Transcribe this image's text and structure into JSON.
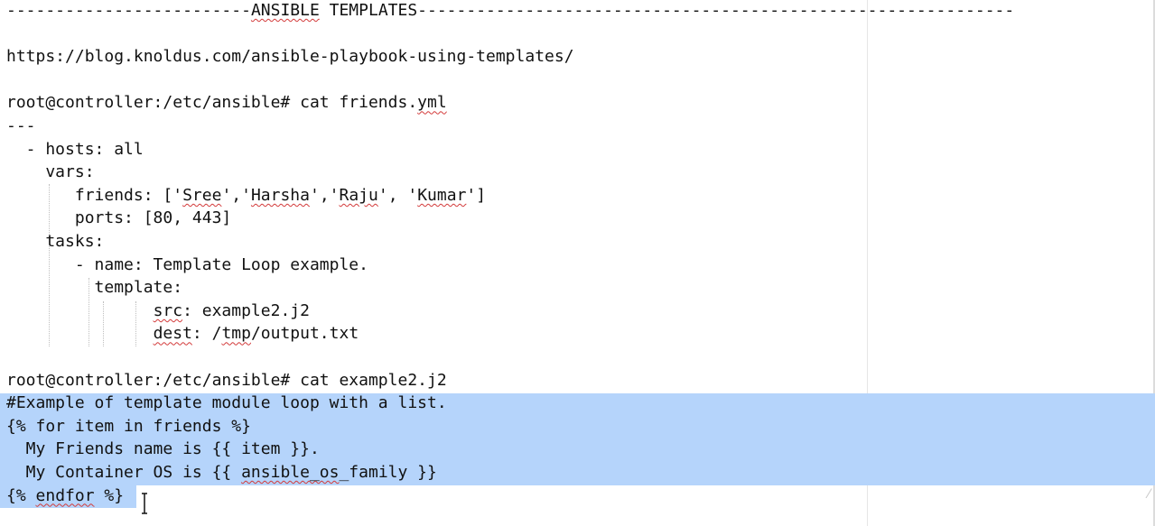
{
  "editor": {
    "lines": [
      {
        "parts": [
          {
            "t": "-------------------------"
          },
          {
            "t": "ANSIBLE",
            "u": true
          },
          {
            "t": " TEMPLATES-------------------------------------------------------------"
          }
        ]
      },
      {
        "parts": [
          {
            "t": ""
          }
        ]
      },
      {
        "parts": [
          {
            "t": "https://blog.knoldus.com/ansible-playbook-using-templates/"
          }
        ]
      },
      {
        "parts": [
          {
            "t": ""
          }
        ]
      },
      {
        "parts": [
          {
            "t": "root@controller:/etc/ansible# cat friends."
          },
          {
            "t": "yml",
            "u": true
          }
        ]
      },
      {
        "parts": [
          {
            "t": "---"
          }
        ]
      },
      {
        "parts": [
          {
            "t": "  - hosts: all"
          }
        ]
      },
      {
        "parts": [
          {
            "t": "    vars:"
          }
        ]
      },
      {
        "parts": [
          {
            "t": "       friends: ['"
          },
          {
            "t": "Sree",
            "u": true
          },
          {
            "t": "','"
          },
          {
            "t": "Harsha",
            "u": true
          },
          {
            "t": "','"
          },
          {
            "t": "Raju",
            "u": true
          },
          {
            "t": "', '"
          },
          {
            "t": "Kumar",
            "u": true
          },
          {
            "t": "']"
          }
        ]
      },
      {
        "parts": [
          {
            "t": "       ports: [80, 443]"
          }
        ]
      },
      {
        "parts": [
          {
            "t": "    tasks:"
          }
        ]
      },
      {
        "parts": [
          {
            "t": "       - name: Template Loop example."
          }
        ]
      },
      {
        "parts": [
          {
            "t": "         template:"
          }
        ]
      },
      {
        "parts": [
          {
            "t": "               "
          },
          {
            "t": "src",
            "u": true
          },
          {
            "t": ": example2.j2"
          }
        ]
      },
      {
        "parts": [
          {
            "t": "               "
          },
          {
            "t": "dest",
            "u": true
          },
          {
            "t": ": /"
          },
          {
            "t": "tmp",
            "u": true
          },
          {
            "t": "/output.txt"
          }
        ]
      },
      {
        "parts": [
          {
            "t": ""
          }
        ]
      },
      {
        "parts": [
          {
            "t": "root@controller:/etc/ansible# cat example2.j2"
          }
        ]
      },
      {
        "parts": [
          {
            "t": "#Example of template module loop with a list."
          }
        ]
      },
      {
        "parts": [
          {
            "t": "{% for item in friends %}"
          }
        ]
      },
      {
        "parts": [
          {
            "t": "  My Friends name is {{ item }}."
          }
        ]
      },
      {
        "parts": [
          {
            "t": "  My Container OS is {{ "
          },
          {
            "t": "ansible_os",
            "u": true
          },
          {
            "t": "_family }}"
          }
        ]
      },
      {
        "parts": [
          {
            "t": "{% "
          },
          {
            "t": "endfor",
            "u": true
          },
          {
            "t": " %}"
          }
        ]
      }
    ]
  },
  "colors": {
    "selection": "#b5d4fb",
    "text": "#111111",
    "spellcheck_underline": "#d33a3a"
  },
  "icons": {
    "cursor": "text-cursor-icon"
  }
}
